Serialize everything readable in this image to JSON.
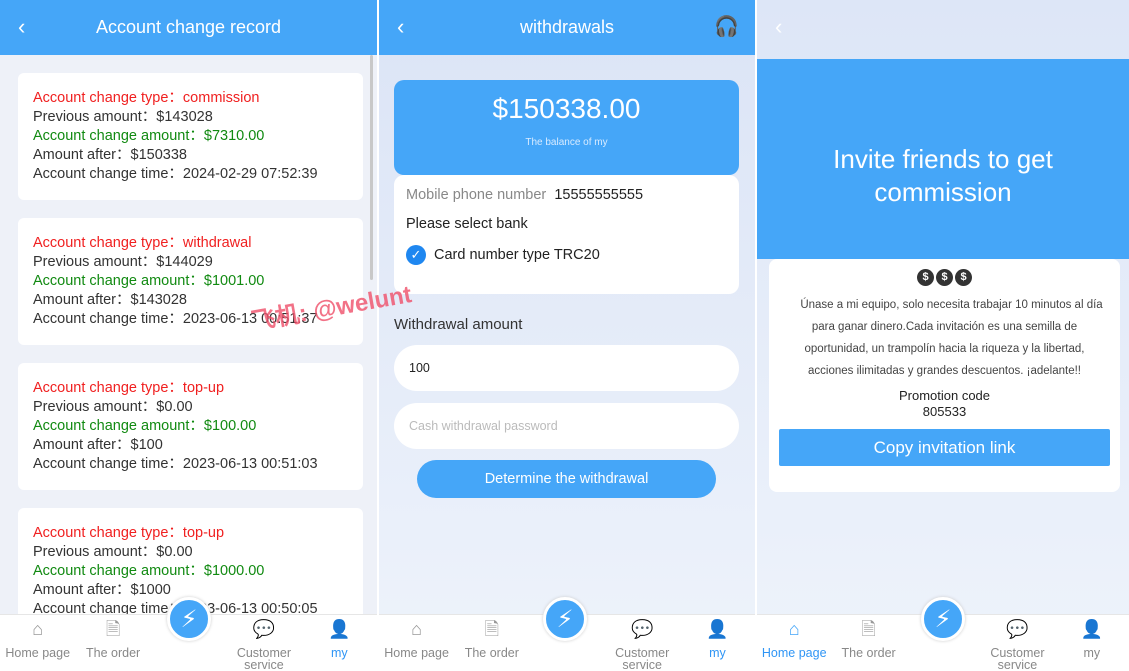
{
  "nav": {
    "items": [
      "Home page",
      "The order",
      "Customer service",
      "my"
    ]
  },
  "watermark": "飞机: @welunt",
  "record": {
    "title": "Account change record",
    "items": [
      {
        "type": "Account change type：commission",
        "prev": "Previous amount：$143028",
        "amount": "Account change amount：$7310.00",
        "after": "Amount after：$150338",
        "time": "Account change time：2024-02-29 07:52:39"
      },
      {
        "type": "Account change type：withdrawal",
        "prev": "Previous amount：$144029",
        "amount": "Account change amount：$1001.00",
        "after": "Amount after：$143028",
        "time": "Account change time：2023-06-13 00:51:37"
      },
      {
        "type": "Account change type：top-up",
        "prev": "Previous amount：$0.00",
        "amount": "Account change amount：$100.00",
        "after": "Amount after：$100",
        "time": "Account change time：2023-06-13 00:51:03"
      },
      {
        "type": "Account change type：top-up",
        "prev": "Previous amount：$0.00",
        "amount": "Account change amount：$1000.00",
        "after": "Amount after：$1000",
        "time": "Account change time：2023-06-13 00:50:05"
      }
    ]
  },
  "withdraw": {
    "title": "withdrawals",
    "balance": "$150338.00",
    "balance_label": "The balance of my",
    "phone_label": "Mobile phone number",
    "phone": "15555555555",
    "bank_label": "Please select bank",
    "bank_option": "Card number type TRC20",
    "amount_label": "Withdrawal amount",
    "amount_value": "100",
    "password_placeholder": "Cash withdrawal password",
    "submit": "Determine the withdrawal"
  },
  "invite": {
    "title": "Invite friends to get commission",
    "text": "Únase a mi equipo, solo necesita trabajar 10 minutos al día para ganar dinero.Cada invitación es una semilla de oportunidad, un trampolín hacia la riqueza y la libertad, acciones ilimitadas y grandes descuentos. ¡adelante!!",
    "promo_label": "Promotion code",
    "promo_code": "805533",
    "copy": "Copy invitation link"
  },
  "colors": {
    "primary": "#45a6f8",
    "red": "#f02020",
    "green": "#118a11"
  }
}
